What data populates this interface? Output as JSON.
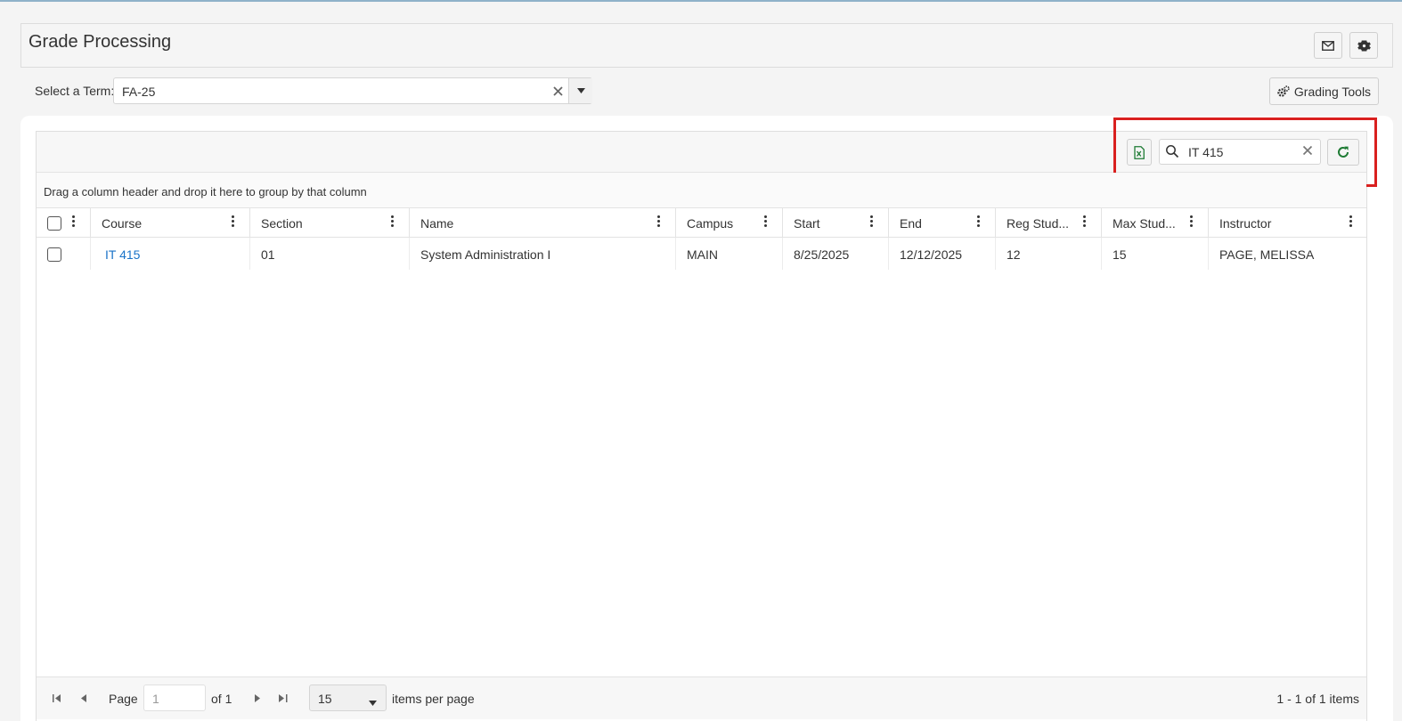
{
  "header": {
    "title": "Grade Processing"
  },
  "icons": {
    "mail": "mail-icon",
    "settings": "gear-icon",
    "excel": "excel-file-icon",
    "search": "search-icon",
    "refresh": "refresh-icon"
  },
  "term": {
    "label": "Select a Term:",
    "value": "FA-25"
  },
  "grading_tools": {
    "label": "Grading Tools"
  },
  "toolbar": {
    "search_value": "IT 415"
  },
  "group_panel": {
    "text": "Drag a column header and drop it here to group by that column"
  },
  "columns": [
    "Course",
    "Section",
    "Name",
    "Campus",
    "Start",
    "End",
    "Reg Stud...",
    "Max Stud...",
    "Instructor"
  ],
  "rows": [
    {
      "course": "IT 415",
      "section": "01",
      "name": "System Administration I",
      "campus": "MAIN",
      "start": "8/25/2025",
      "end": "12/12/2025",
      "reg": "12",
      "max": "15",
      "instructor": "PAGE, MELISSA"
    }
  ],
  "pager": {
    "page_label": "Page",
    "page_value": "1",
    "of_label": "of 1",
    "per_page_value": "15",
    "per_page_label": "items per page",
    "summary": "1 - 1 of 1 items"
  },
  "colors": {
    "link": "#1a73c8",
    "highlight": "#d9201f",
    "excel_green": "#1e7b34"
  }
}
